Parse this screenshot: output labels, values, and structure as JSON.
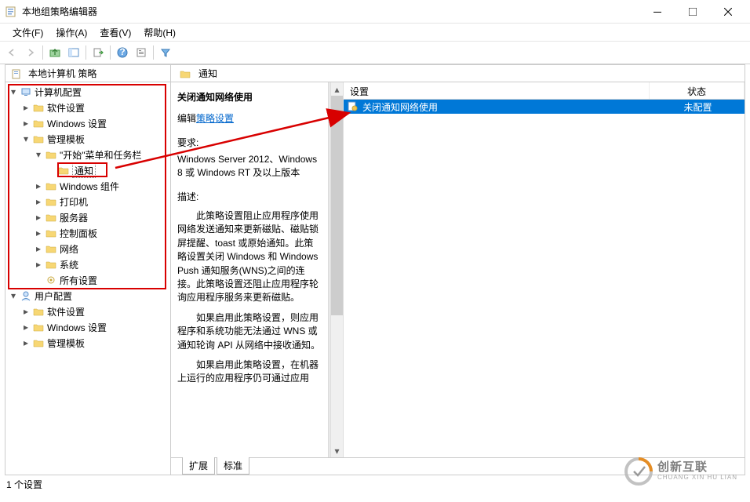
{
  "window": {
    "title": "本地组策略编辑器"
  },
  "menu": {
    "file": "文件(F)",
    "action": "操作(A)",
    "view": "查看(V)",
    "help": "帮助(H)"
  },
  "tree": {
    "root": "本地计算机 策略",
    "computer_cfg": "计算机配置",
    "software": "软件设置",
    "windows_settings": "Windows 设置",
    "admin_templates": "管理模板",
    "start_task": "\"开始\"菜单和任务栏",
    "notify": "通知",
    "win_components": "Windows 组件",
    "printers": "打印机",
    "servers": "服务器",
    "control_panel": "控制面板",
    "network": "网络",
    "system": "系统",
    "all_settings": "所有设置",
    "user_cfg": "用户配置",
    "u_software": "软件设置",
    "u_windows_settings": "Windows 设置",
    "u_admin_templates": "管理模板"
  },
  "right": {
    "header": "通知",
    "title": "关闭通知网络使用",
    "edit_prefix": "编辑",
    "edit_link": "策略设置",
    "req_label": "要求:",
    "req_body": "Windows Server 2012、Windows 8 或 Windows RT 及以上版本",
    "desc_label": "描述:",
    "p1": "此策略设置阻止应用程序使用网络发送通知来更新磁贴、磁贴锁屏提醒、toast 或原始通知。此策略设置关闭 Windows 和 Windows Push 通知服务(WNS)之间的连接。此策略设置还阻止应用程序轮询应用程序服务来更新磁贴。",
    "p2": "如果启用此策略设置，则应用程序和系统功能无法通过 WNS 或通知轮询 API 从网络中接收通知。",
    "p3": "如果启用此策略设置，在机器上运行的应用程序仍可通过应用",
    "col_setting": "设置",
    "col_status": "状态"
  },
  "list": {
    "rows": [
      {
        "name": "关闭通知网络使用",
        "status": "未配置"
      }
    ]
  },
  "tabs": {
    "extended": "扩展",
    "standard": "标准"
  },
  "status": {
    "count": "1 个设置"
  },
  "watermark": {
    "cn": "创新互联",
    "py": "CHUANG XIN HU LIAN"
  }
}
